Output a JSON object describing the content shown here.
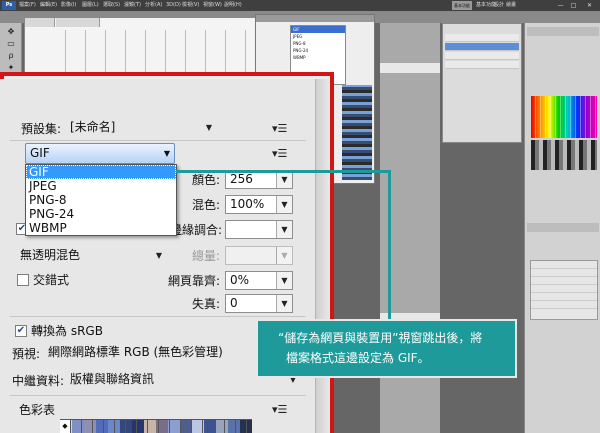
{
  "app": {
    "menu": [
      "檔案(F)",
      "編輯(E)",
      "影像(I)",
      "圖層(L)",
      "選取(S)",
      "濾鏡(T)",
      "分析(A)",
      "3D(D)",
      "檢視(V)",
      "視窗(W)",
      "說明(H)"
    ],
    "workspace_essentials": "基本功能",
    "workspace_names": [
      "基本功能",
      "設計",
      "繪畫"
    ],
    "window_controls": [
      "—",
      "□",
      "✕"
    ],
    "logo": "Ps"
  },
  "dialog": {
    "preset_label": "預設集:",
    "preset_value": "[未命名]",
    "menu_icon": "▾☰",
    "format_value": "GIF",
    "format_options": [
      "GIF",
      "JPEG",
      "PNG-8",
      "PNG-24",
      "WBMP"
    ],
    "colors_label": "顏色:",
    "colors_value": "256",
    "dither_label": "混色:",
    "dither_value": "100%",
    "matte_label": "邊緣調合:",
    "matte_value": "",
    "amount_label": "總量:",
    "amount_value": "",
    "transparency_dither_value": "無透明混色",
    "interlaced_label": "交錯式",
    "web_snap_label": "網頁靠齊:",
    "web_snap_value": "0%",
    "lossy_label": "失真:",
    "lossy_value": "0",
    "convert_srgb_label": "轉換為 sRGB",
    "preview_label": "預視:",
    "preview_value": "網際網路標準 RGB (無色彩管理)",
    "metadata_label": "中繼資料:",
    "metadata_value": "版權與聯絡資訊",
    "color_table_label": "色彩表"
  },
  "callout": {
    "line1": "“儲存為網頁與裝置用”視窗跳出後，將",
    "line2": "檔案格式這邊設定為 GIF。"
  },
  "colors": {
    "accent_red": "#d21616",
    "callout_teal": "#1f9a9a",
    "selection_blue": "#3399ff"
  }
}
